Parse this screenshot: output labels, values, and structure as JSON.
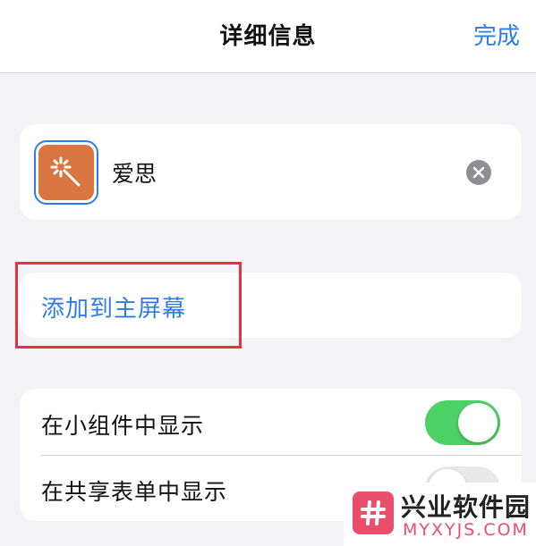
{
  "navbar": {
    "title": "详细信息",
    "done_label": "完成"
  },
  "shortcut": {
    "icon": "magic-wand-icon",
    "icon_color": "#d9763f",
    "name_value": "爱思"
  },
  "actions": {
    "add_to_home_label": "添加到主屏幕"
  },
  "toggles": [
    {
      "label": "在小组件中显示",
      "on": true
    },
    {
      "label": "在共享表单中显示",
      "on": false
    }
  ],
  "watermark": {
    "title": "兴业软件园",
    "subtitle": "MYXYJS.COM"
  },
  "colors": {
    "accent": "#2f7ce8",
    "switch_on": "#4cd164",
    "highlight": "#e8323c"
  }
}
